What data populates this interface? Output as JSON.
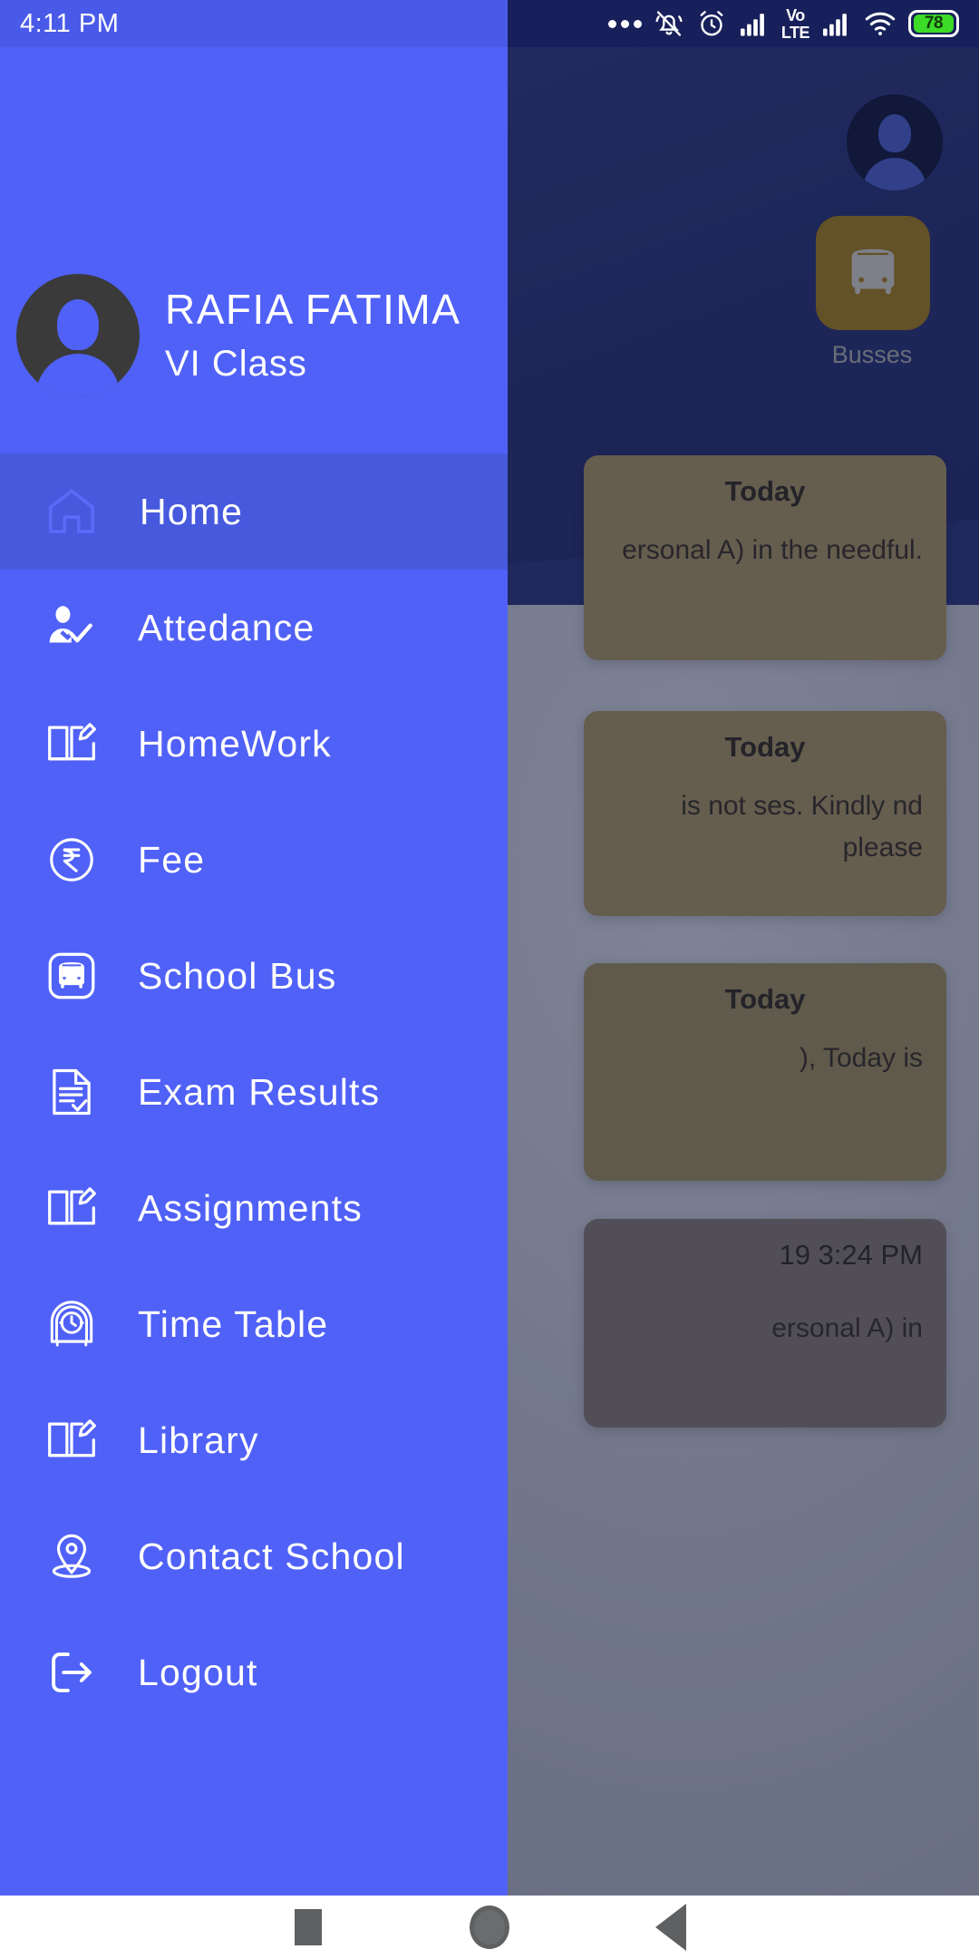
{
  "status_bar": {
    "time": "4:11 PM",
    "battery_level": "78",
    "icons": [
      "more-dots-icon",
      "bell-muted-icon",
      "alarm-clock-icon",
      "signal-bars-icon",
      "volte-icon",
      "signal-bars-icon",
      "wifi-icon",
      "battery-icon"
    ],
    "volte_label_top": "Vo",
    "volte_label_bottom": "LTE"
  },
  "drawer": {
    "profile": {
      "name": "RAFIA FATIMA",
      "class": "VI Class",
      "avatar_icon": "user-avatar-icon"
    },
    "items": [
      {
        "label": "Home",
        "icon": "home-icon",
        "selected": true
      },
      {
        "label": "Attedance",
        "icon": "attendance-icon",
        "selected": false
      },
      {
        "label": "HomeWork",
        "icon": "book-pencil-icon",
        "selected": false
      },
      {
        "label": "Fee",
        "icon": "rupee-circle-icon",
        "selected": false
      },
      {
        "label": "School Bus",
        "icon": "bus-icon",
        "selected": false
      },
      {
        "label": "Exam Results",
        "icon": "document-check-icon",
        "selected": false
      },
      {
        "label": "Assignments",
        "icon": "book-pencil-icon",
        "selected": false
      },
      {
        "label": "Time Table",
        "icon": "alarm-clock-icon",
        "selected": false
      },
      {
        "label": "Library",
        "icon": "book-pencil-icon",
        "selected": false
      },
      {
        "label": "Contact School",
        "icon": "location-pin-icon",
        "selected": false
      },
      {
        "label": "Logout",
        "icon": "logout-icon",
        "selected": false
      }
    ]
  },
  "background": {
    "avatar_icon": "user-avatar-icon",
    "tile": {
      "label": "Busses",
      "icon": "bus-icon",
      "color": "#9a7510"
    },
    "notices": [
      {
        "date": "Today",
        "text": "ersonal  A) in the needful."
      },
      {
        "date": "Today",
        "text": "is not ses. Kindly nd please"
      },
      {
        "date": "Today",
        "text": "), Today is"
      },
      {
        "timestamp": "19 3:24 PM",
        "text": "ersonal A) in"
      }
    ]
  },
  "navbar": {
    "buttons": [
      {
        "name": "recents-button",
        "icon": "square-icon"
      },
      {
        "name": "home-button",
        "icon": "circle-icon"
      },
      {
        "name": "back-button",
        "icon": "triangle-back-icon"
      }
    ]
  },
  "colors": {
    "drawer_bg": "#5061f7",
    "drawer_selected": "#4759dd",
    "status_bar_left": "#4a5ae8",
    "status_bar_right": "#17205a",
    "battery_fill": "#3cdb28"
  }
}
